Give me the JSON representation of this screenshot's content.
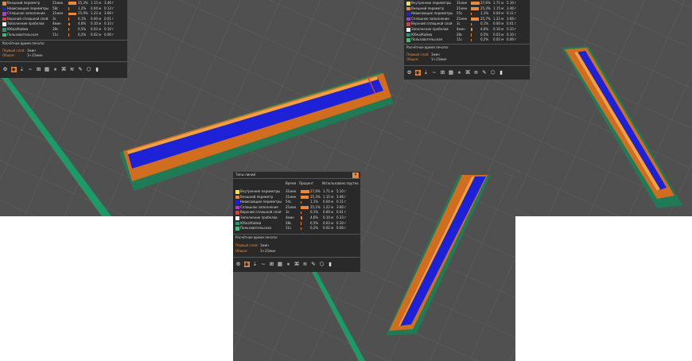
{
  "legend_rows": [
    {
      "key": "inner_perimeter",
      "label": "Внутренние периметры",
      "time": "31мин",
      "pct": "27,6%",
      "len": "1.71 м",
      "wt": "5.10 г",
      "color": "#f2e14a",
      "bar": 0.276
    },
    {
      "key": "outer_perimeter",
      "label": "Внешний периметр",
      "time": "21мин",
      "pct": "25,3%",
      "len": "1.15 м",
      "wt": "3.46 г",
      "color": "#e8893d",
      "bar": 0.253
    },
    {
      "key": "overhang_perimeter",
      "label": "Нависающие периметры",
      "time": "54с",
      "pct": "1,1%",
      "len": "0.04 м",
      "wt": "0.11 г",
      "color": "#1e22d6",
      "bar": 0.011
    },
    {
      "key": "solid_infill",
      "label": "Сплошное заполнение",
      "time": "21мин",
      "pct": "25,1%",
      "len": "1.22 м",
      "wt": "3.66 г",
      "color": "#b03ad8",
      "bar": 0.251
    },
    {
      "key": "top_solid",
      "label": "Верхний сплошной слой",
      "time": "3с",
      "pct": "0,1%",
      "len": "0.00 м",
      "wt": "0.01 г",
      "color": "#e03a3a",
      "bar": 0.001
    },
    {
      "key": "gap_fill",
      "label": "Заполнение пробелов",
      "time": "4мин",
      "pct": "4,6%",
      "len": "0.10 м",
      "wt": "0.33 г",
      "color": "#f0f0f0",
      "bar": 0.046
    },
    {
      "key": "skirt",
      "label": "Юбка/Кайма",
      "time": "28с",
      "pct": "0,5%",
      "len": "0.03 м",
      "wt": "0.10 г",
      "color": "#1f9a78",
      "bar": 0.005
    },
    {
      "key": "custom",
      "label": "Пользовательская",
      "time": "11с",
      "pct": "0,2%",
      "len": "0.02 м",
      "wt": "0.06 г",
      "color": "#33c46a",
      "bar": 0.002
    }
  ],
  "panel_top_left": {
    "rows": [
      {
        "label": "Внешний периметр",
        "time": "21мин",
        "pct": "25,3%",
        "len": "1.15 м",
        "wt": "3.46 г",
        "color": "#e8893d",
        "bar": 0.253
      },
      {
        "label": "Нависающие периметры",
        "time": "58с",
        "pct": "1,2%",
        "len": "0.04 м",
        "wt": "0.13 г",
        "color": "#1e22d6",
        "bar": 0.012
      },
      {
        "label": "Сплошное заполнение",
        "time": "21мин",
        "pct": "25,9%",
        "len": "1.22 м",
        "wt": "3.66 г",
        "color": "#b03ad8",
        "bar": 0.259
      },
      {
        "label": "Верхний сплошной слой",
        "time": "3с",
        "pct": "0,1%",
        "len": "0.00 м",
        "wt": "0.01 г",
        "color": "#e03a3a",
        "bar": 0.001
      },
      {
        "label": "Заполнение пробелов",
        "time": "4мин",
        "pct": "4,6%",
        "len": "0.10 м",
        "wt": "0.33 г",
        "color": "#f0f0f0",
        "bar": 0.046
      },
      {
        "label": "Юбка/Кайма",
        "time": "28с",
        "pct": "0,5%",
        "len": "0.03 м",
        "wt": "0.10 г",
        "color": "#1f9a78",
        "bar": 0.005
      },
      {
        "label": "Пользовательская",
        "time": "11с",
        "pct": "0,2%",
        "len": "0.02 м",
        "wt": "0.06 г",
        "color": "#33c46a",
        "bar": 0.002
      }
    ]
  },
  "panel_top_right": {
    "rows": [
      {
        "label": "Внутренние периметры",
        "time": "31мин",
        "pct": "27,6%",
        "len": "1.71 м",
        "wt": "5.10 г",
        "color": "#f2e14a",
        "bar": 0.276
      },
      {
        "label": "Внешний периметр",
        "time": "21мин",
        "pct": "25,3%",
        "len": "1.15 м",
        "wt": "3.46 г",
        "color": "#e8893d",
        "bar": 0.253
      },
      {
        "label": "Нависающие периметры",
        "time": "55с",
        "pct": "1,1%",
        "len": "0.04 м",
        "wt": "0.11 г",
        "color": "#1e22d6",
        "bar": 0.011
      },
      {
        "label": "Сплошное заполнение",
        "time": "21мин",
        "pct": "25,7%",
        "len": "1.22 м",
        "wt": "3.66 г",
        "color": "#b03ad8",
        "bar": 0.257
      },
      {
        "label": "Верхний сплошной слой",
        "time": "3с",
        "pct": "0,1%",
        "len": "0.00 м",
        "wt": "0.01 г",
        "color": "#e03a3a",
        "bar": 0.001
      },
      {
        "label": "Заполнение пробелов",
        "time": "4мин",
        "pct": "4,6%",
        "len": "0.10 м",
        "wt": "0.33 г",
        "color": "#f0f0f0",
        "bar": 0.046
      },
      {
        "label": "Юбка/Кайма",
        "time": "28с",
        "pct": "0,5%",
        "len": "0.03 м",
        "wt": "0.10 г",
        "color": "#1f9a78",
        "bar": 0.005
      },
      {
        "label": "Пользовательская",
        "time": "11с",
        "pct": "0,2%",
        "len": "0.02 м",
        "wt": "0.06 г",
        "color": "#33c46a",
        "bar": 0.002
      }
    ]
  },
  "panel_center": {
    "title": "Типы линий",
    "col_time": "Время",
    "col_pct": "Процент",
    "col_used": "Использовано прутка"
  },
  "estimated_time_label": "Расчётное время печати:",
  "first_layer_label": "Первый слой:",
  "first_layer_value": "1мин",
  "total_label": "Общее:",
  "total_value": "1ч 21мин",
  "dropdown_glyph": "▾",
  "toolbar_icons": [
    "gcode-viewer-icon",
    "filament-icon",
    "retraction-icon",
    "wipe-icon",
    "seam-icon",
    "color-change-icon",
    "pause-icon",
    "custom-gcode-icon",
    "shells-icon",
    "tool-marker-icon",
    "ghost-icon",
    "legend-icon"
  ],
  "toolbar_glyphs": [
    "⚙",
    "◉",
    "⇣",
    "~",
    "⊞",
    "▦",
    "⏸",
    "⌘",
    "≋",
    "✎",
    "⬡",
    "▮"
  ]
}
